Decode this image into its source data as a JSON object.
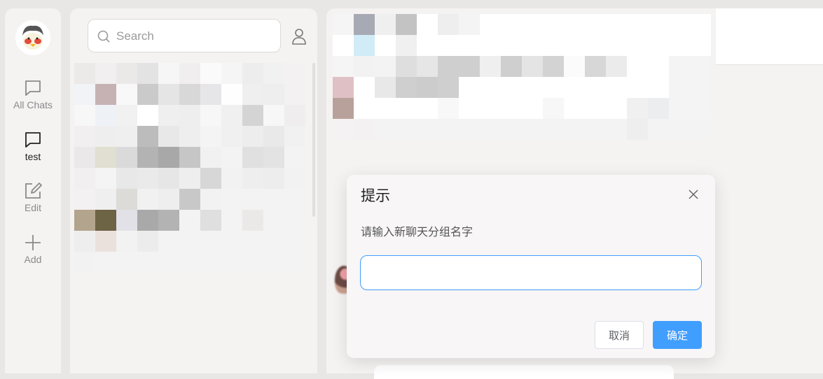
{
  "sidebar": {
    "items": [
      {
        "label": "All Chats",
        "icon": "chat-bubble-icon"
      },
      {
        "label": "test",
        "icon": "chat-bubble-icon"
      },
      {
        "label": "Edit",
        "icon": "edit-icon"
      },
      {
        "label": "Add",
        "icon": "plus-icon"
      }
    ]
  },
  "search": {
    "placeholder": "Search"
  },
  "dialog": {
    "title": "提示",
    "message": "请输入新聊天分组名字",
    "input_value": "",
    "cancel_label": "取消",
    "confirm_label": "确定"
  },
  "colors": {
    "accent": "#409eff",
    "background": "#e9e6e6",
    "panel": "#f5f2f2"
  }
}
